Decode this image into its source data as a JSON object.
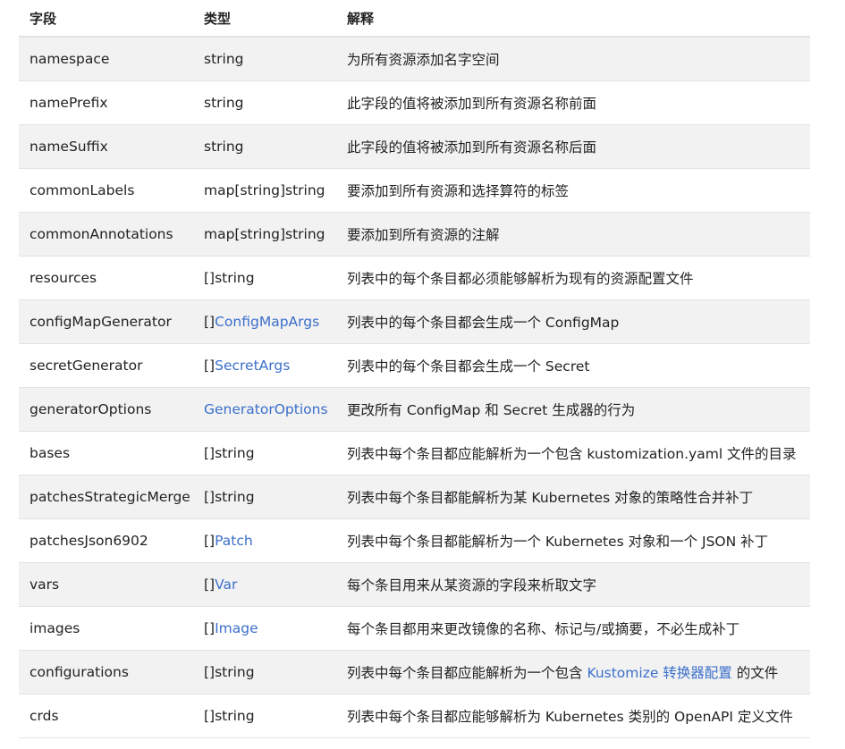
{
  "headers": [
    "字段",
    "类型",
    "解释"
  ],
  "link_color": "#3b6fcb",
  "rows": [
    {
      "field": "namespace",
      "type_prefix": "",
      "type_text": "string",
      "type_link": "",
      "desc_before": "为所有资源添加名字空间",
      "desc_link": "",
      "desc_after": ""
    },
    {
      "field": "namePrefix",
      "type_prefix": "",
      "type_text": "string",
      "type_link": "",
      "desc_before": "此字段的值将被添加到所有资源名称前面",
      "desc_link": "",
      "desc_after": ""
    },
    {
      "field": "nameSuffix",
      "type_prefix": "",
      "type_text": "string",
      "type_link": "",
      "desc_before": "此字段的值将被添加到所有资源名称后面",
      "desc_link": "",
      "desc_after": ""
    },
    {
      "field": "commonLabels",
      "type_prefix": "",
      "type_text": "map[string]string",
      "type_link": "",
      "desc_before": "要添加到所有资源和选择算符的标签",
      "desc_link": "",
      "desc_after": ""
    },
    {
      "field": "commonAnnotations",
      "type_prefix": "",
      "type_text": "map[string]string",
      "type_link": "",
      "desc_before": "要添加到所有资源的注解",
      "desc_link": "",
      "desc_after": ""
    },
    {
      "field": "resources",
      "type_prefix": "",
      "type_text": "[]string",
      "type_link": "",
      "desc_before": "列表中的每个条目都必须能够解析为现有的资源配置文件",
      "desc_link": "",
      "desc_after": ""
    },
    {
      "field": "configMapGenerator",
      "type_prefix": "[]",
      "type_text": "",
      "type_link": "ConfigMapArgs",
      "desc_before": "列表中的每个条目都会生成一个 ConfigMap",
      "desc_link": "",
      "desc_after": ""
    },
    {
      "field": "secretGenerator",
      "type_prefix": "[]",
      "type_text": "",
      "type_link": "SecretArgs",
      "desc_before": "列表中的每个条目都会生成一个 Secret",
      "desc_link": "",
      "desc_after": ""
    },
    {
      "field": "generatorOptions",
      "type_prefix": "",
      "type_text": "",
      "type_link": "GeneratorOptions",
      "desc_before": "更改所有 ConfigMap 和 Secret 生成器的行为",
      "desc_link": "",
      "desc_after": ""
    },
    {
      "field": "bases",
      "type_prefix": "",
      "type_text": "[]string",
      "type_link": "",
      "desc_before": "列表中每个条目都应能解析为一个包含 kustomization.yaml 文件的目录",
      "desc_link": "",
      "desc_after": ""
    },
    {
      "field": "patchesStrategicMerge",
      "type_prefix": "",
      "type_text": "[]string",
      "type_link": "",
      "desc_before": "列表中每个条目都能解析为某 Kubernetes 对象的策略性合并补丁",
      "desc_link": "",
      "desc_after": ""
    },
    {
      "field": "patchesJson6902",
      "type_prefix": "[]",
      "type_text": "",
      "type_link": "Patch",
      "desc_before": "列表中每个条目都能解析为一个 Kubernetes 对象和一个 JSON 补丁",
      "desc_link": "",
      "desc_after": ""
    },
    {
      "field": "vars",
      "type_prefix": "[]",
      "type_text": "",
      "type_link": "Var",
      "desc_before": "每个条目用来从某资源的字段来析取文字",
      "desc_link": "",
      "desc_after": ""
    },
    {
      "field": "images",
      "type_prefix": "[]",
      "type_text": "",
      "type_link": "Image",
      "desc_before": "每个条目都用来更改镜像的名称、标记与/或摘要，不必生成补丁",
      "desc_link": "",
      "desc_after": ""
    },
    {
      "field": "configurations",
      "type_prefix": "",
      "type_text": "[]string",
      "type_link": "",
      "desc_before": "列表中每个条目都应能解析为一个包含 ",
      "desc_link": "Kustomize 转换器配置",
      "desc_after": " 的文件"
    },
    {
      "field": "crds",
      "type_prefix": "",
      "type_text": "[]string",
      "type_link": "",
      "desc_before": "列表中每个条目都应能够解析为 Kubernetes 类别的 OpenAPI 定义文件",
      "desc_link": "",
      "desc_after": ""
    }
  ]
}
